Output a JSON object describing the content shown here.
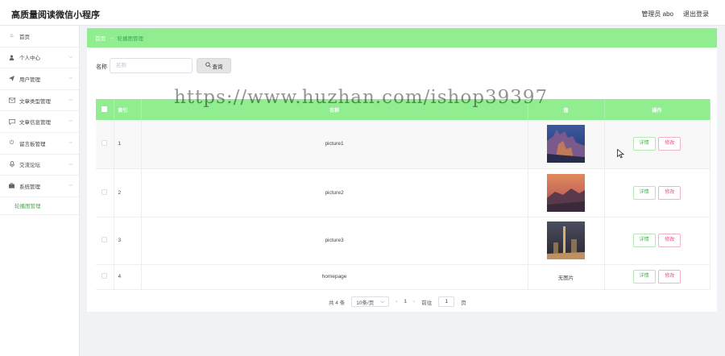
{
  "app": {
    "title": "高质量阅读微信小程序"
  },
  "header": {
    "user_label": "管理员 abo",
    "logout_label": "退出登录"
  },
  "sidebar": {
    "items": [
      {
        "label": "首页",
        "icon": "home-icon",
        "has_arrow": false
      },
      {
        "label": "个人中心",
        "icon": "user-icon",
        "has_arrow": true
      },
      {
        "label": "用户管理",
        "icon": "send-icon",
        "has_arrow": true
      },
      {
        "label": "文章类型管理",
        "icon": "mail-icon",
        "has_arrow": true
      },
      {
        "label": "文章信息管理",
        "icon": "chat-icon",
        "has_arrow": true
      },
      {
        "label": "留言板管理",
        "icon": "power-icon",
        "has_arrow": true
      },
      {
        "label": "交流论坛",
        "icon": "microphone-icon",
        "has_arrow": true
      },
      {
        "label": "系统管理",
        "icon": "briefcase-icon",
        "has_arrow": true
      }
    ],
    "sub_item": "轮播图管理"
  },
  "breadcrumb": {
    "home": "首页",
    "separator": "→",
    "current": "轮播图管理"
  },
  "search": {
    "label": "名称",
    "placeholder": "名称",
    "button_label": "查询"
  },
  "table": {
    "headers": {
      "index": "索引",
      "name": "名称",
      "image": "值",
      "actions": "操作"
    },
    "rows": [
      {
        "index": "1",
        "name": "picture1",
        "image": "photo",
        "detail": "详情",
        "edit": "修改"
      },
      {
        "index": "2",
        "name": "picture2",
        "image": "photo",
        "detail": "详情",
        "edit": "修改"
      },
      {
        "index": "3",
        "name": "picture3",
        "image": "photo",
        "detail": "详情",
        "edit": "修改"
      },
      {
        "index": "4",
        "name": "homepage",
        "image_text": "无图片",
        "detail": "详情",
        "edit": "修改"
      }
    ]
  },
  "pagination": {
    "total": "共 4 条",
    "page_size": "10条/页",
    "current_page": "1",
    "goto_label": "前往",
    "goto_value": "1",
    "page_suffix": "页"
  },
  "watermark": "https://www.huzhan.com/ishop39397",
  "colors": {
    "accent": "#90ee90",
    "accent_text": "#3aa85a",
    "edit": "#e0518a"
  }
}
